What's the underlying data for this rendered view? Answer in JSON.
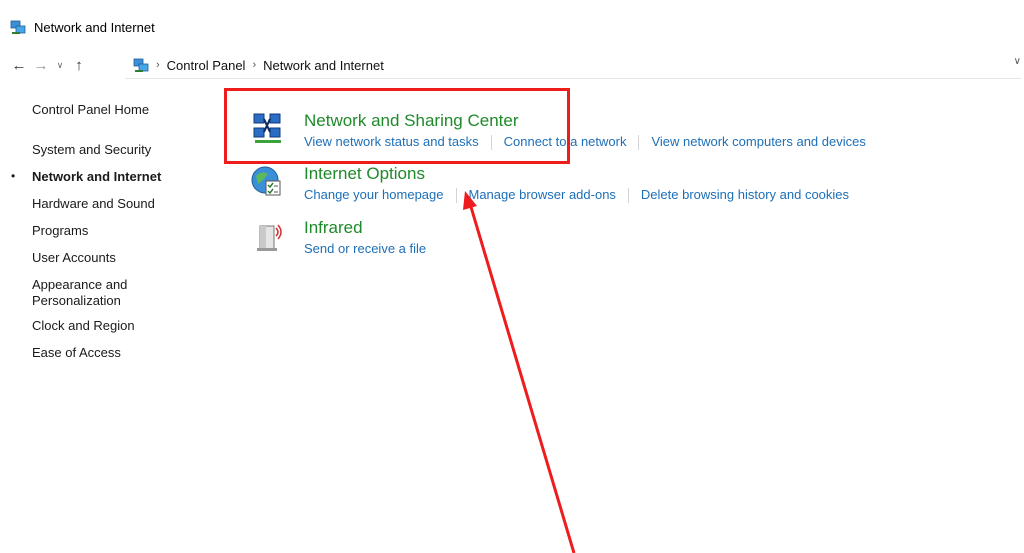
{
  "window": {
    "title": "Network and Internet"
  },
  "address_bar": {
    "breadcrumbs": [
      "Control Panel",
      "Network and Internet"
    ]
  },
  "sidebar": {
    "items": [
      "Control Panel Home",
      "System and Security",
      "Network and Internet",
      "Hardware and Sound",
      "Programs",
      "User Accounts",
      "Appearance and\nPersonalization",
      "Clock and Region",
      "Ease of Access"
    ],
    "current_bullet": "•"
  },
  "categories": [
    {
      "title": "Network and Sharing Center",
      "icon": "network-sharing-icon",
      "links": [
        "View network status and tasks",
        "Connect to a network",
        "View network computers and devices"
      ]
    },
    {
      "title": "Internet Options",
      "icon": "internet-options-icon",
      "links": [
        "Change your homepage",
        "Manage browser add-ons",
        "Delete browsing history and cookies"
      ]
    },
    {
      "title": "Infrared",
      "icon": "infrared-icon",
      "links": [
        "Send or receive a file"
      ]
    }
  ],
  "annotation": {
    "highlight_color": "#ee1c1c",
    "arrow_color": "#ee1c1c"
  },
  "colors": {
    "category_title": "#1e8a2a",
    "link": "#1d6fb8"
  }
}
